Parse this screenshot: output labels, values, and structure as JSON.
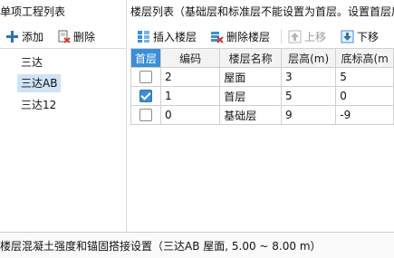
{
  "left_panel": {
    "title": "单项工程列表",
    "add_label": "添加",
    "delete_label": "删除",
    "items": [
      {
        "label": "三达"
      },
      {
        "label": "三达AB",
        "selected": true
      },
      {
        "label": "三达12"
      }
    ]
  },
  "right_panel": {
    "title": "楼层列表（基础层和标准层不能设置为首层。设置首层后",
    "toolbar": {
      "insert_label": "插入楼层",
      "delete_label": "删除楼层",
      "up_label": "上移",
      "down_label": "下移"
    },
    "table": {
      "headers": [
        "首层",
        "编码",
        "楼层名称",
        "层高(m)",
        "底标高(m"
      ],
      "rows": [
        {
          "is_first": false,
          "code": "2",
          "name": "屋面",
          "height": "3",
          "base": "5"
        },
        {
          "is_first": true,
          "code": "1",
          "name": "首层",
          "height": "5",
          "base": "0"
        },
        {
          "is_first": false,
          "code": "0",
          "name": "基础层",
          "height": "9",
          "base": "-9"
        }
      ]
    }
  },
  "status_bar": {
    "text": "楼层混凝土强度和锚固搭接设置（三达AB  屋面, 5.00 ~ 8.00 m）"
  },
  "colors": {
    "accent": "#3b8fd9",
    "selection": "#cfe3f7"
  },
  "icons": {
    "add": "plus-icon",
    "delete": "delete-doc-icon",
    "insert": "insert-rows-icon",
    "delete_floor": "delete-rows-icon",
    "up": "arrow-up-icon",
    "down": "arrow-down-icon"
  }
}
